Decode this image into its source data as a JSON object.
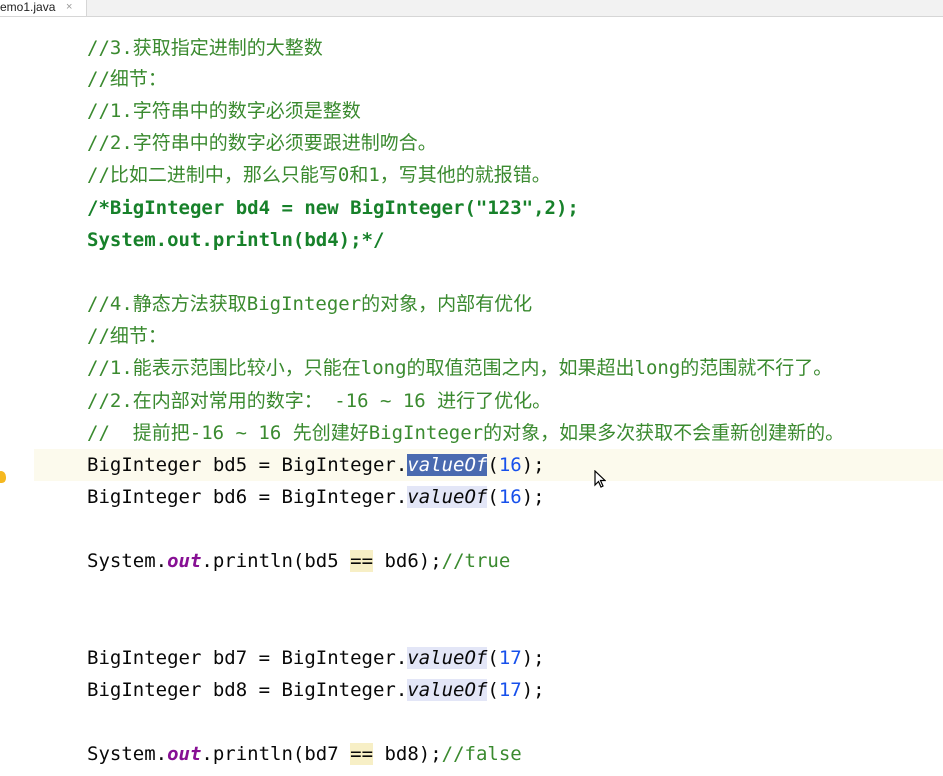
{
  "tab": {
    "filename": "emo1.java",
    "close": "×"
  },
  "icons": {
    "bulb": "lightbulb-icon",
    "cursor": "mouse-pointer-icon"
  },
  "lines": [
    "//3.获取指定进制的大整数",
    "//细节：",
    "//1.字符串中的数字必须是整数",
    "//2.字符串中的数字必须要跟进制吻合。",
    "//比如二进制中，那么只能写0和1，写其他的就报错。",
    "/*BigInteger bd4 = new BigInteger(\"123\",2);",
    "System.out.println(bd4);*/",
    "//4.静态方法获取BigInteger的对象，内部有优化",
    "//细节：",
    "//1.能表示范围比较小，只能在long的取值范围之内，如果超出long的范围就不行了。",
    "//2.在内部对常用的数字： -16 ~ 16 进行了优化。",
    "//  提前把-16 ~ 16 先创建好BigInteger的对象，如果多次获取不会重新创建新的。",
    "BigInteger bd5 = BigInteger.valueOf(16);",
    "BigInteger bd6 = BigInteger.valueOf(16);",
    "System.out.println(bd5 == bd6);//true",
    "BigInteger bd7 = BigInteger.valueOf(17);",
    "BigInteger bd8 = BigInteger.valueOf(17);",
    "System.out.println(bd7 == bd8);//false"
  ],
  "colors": {
    "comment": "#3a8a2f",
    "selection": "#4a6ab0",
    "method_highlight": "#e3e6f7",
    "operator_highlight": "#f7efc6",
    "static_field": "#871094"
  }
}
